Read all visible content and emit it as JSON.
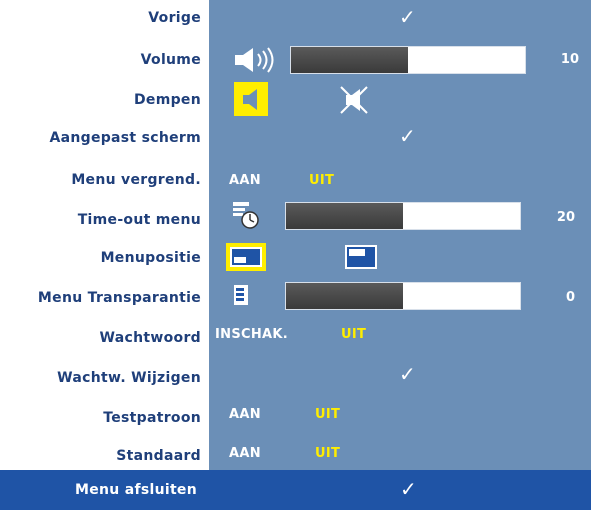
{
  "menu": {
    "labels": [
      "Vorige",
      "Volume",
      "Dempen",
      "Aangepast scherm",
      "Menu vergrend.",
      "Time-out menu",
      "Menupositie",
      "Menu Transparantie",
      "Wachtwoord",
      "Wachtw. Wijzigen",
      "Testpatroon",
      "Standaard"
    ],
    "footer_label": "Menu afsluiten"
  },
  "volume": {
    "value": "10",
    "level": 0.5,
    "icon": "speaker-icon"
  },
  "mute": {
    "icon_on": "speaker-icon",
    "icon_off": "speaker-muted-icon",
    "selected": "on"
  },
  "menu_lock": {
    "on": "AAN",
    "off": "UIT",
    "selected": "off"
  },
  "timeout": {
    "value": "20",
    "level": 0.5,
    "icon": "timer-icon"
  },
  "menu_position": {
    "icons": [
      "position-left-icon",
      "position-right-icon"
    ],
    "selected": 0
  },
  "transparency": {
    "value": "0",
    "level": 0.5,
    "icon": "transparency-icon"
  },
  "password": {
    "on": "INSCHAK.",
    "off": "UIT",
    "selected": "off"
  },
  "test_pattern": {
    "on": "AAN",
    "off": "UIT",
    "selected": "off"
  },
  "default": {
    "on": "AAN",
    "off": "UIT",
    "selected": "off"
  },
  "check_glyph": "✓",
  "colors": {
    "panel": "#6b8fb7",
    "label_text": "#1f3f7a",
    "selected": "#ffee00",
    "footer": "#1f54a6"
  }
}
